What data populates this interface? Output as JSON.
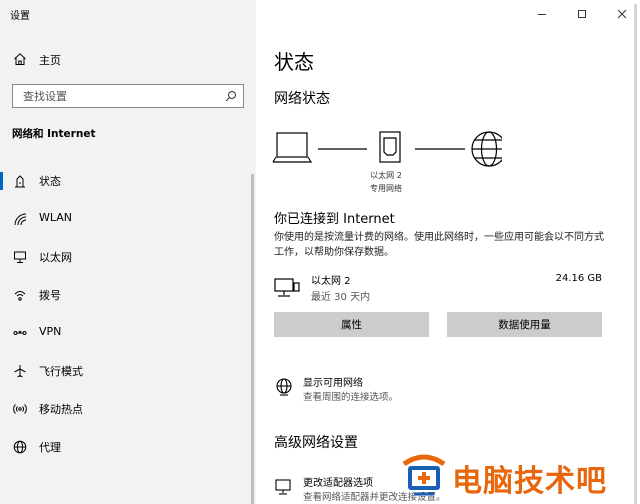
{
  "window": {
    "title": "设置"
  },
  "sidebar": {
    "home_label": "主页",
    "search_placeholder": "查找设置",
    "section_title": "网络和 Internet",
    "items": [
      {
        "label": "状态",
        "icon": "status-icon",
        "active": true
      },
      {
        "label": "WLAN",
        "icon": "wifi-icon"
      },
      {
        "label": "以太网",
        "icon": "ethernet-icon"
      },
      {
        "label": "拨号",
        "icon": "dialup-icon"
      },
      {
        "label": "VPN",
        "icon": "vpn-icon"
      },
      {
        "label": "飞行模式",
        "icon": "airplane-icon"
      },
      {
        "label": "移动热点",
        "icon": "hotspot-icon"
      },
      {
        "label": "代理",
        "icon": "proxy-globe-icon"
      }
    ]
  },
  "main": {
    "title": "状态",
    "network_status_heading": "网络状态",
    "diagram": {
      "device_label_line1": "以太网 2",
      "device_label_line2": "专用网络"
    },
    "connected_title": "你已连接到 Internet",
    "connected_desc": "你使用的是按流量计费的网络。使用此网络时，一些应用可能会以不同方式工作，以帮助你保存数据。",
    "network": {
      "name": "以太网 2",
      "period": "最近 30 天内",
      "usage": "24.16 GB"
    },
    "buttons": {
      "properties": "属性",
      "data_usage": "数据使用量"
    },
    "show_networks": {
      "title": "显示可用网络",
      "desc": "查看周围的连接选项。"
    },
    "advanced_heading": "高级网络设置",
    "adapter_options": {
      "title": "更改适配器选项",
      "desc": "查看网络适配器并更改连接设置。"
    }
  },
  "watermark": {
    "text": "电脑技术吧"
  },
  "colors": {
    "accent": "#0067c0",
    "sidebar_bg": "#f2f2f2",
    "button_bg": "#cccccc",
    "watermark": "#e8670c"
  }
}
